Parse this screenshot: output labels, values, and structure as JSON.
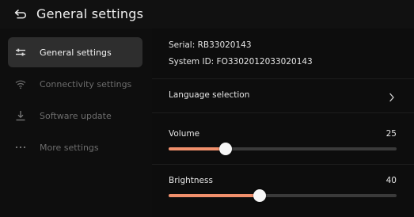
{
  "header": {
    "title": "General settings",
    "back_icon": "back-arrow-icon"
  },
  "sidebar": {
    "items": [
      {
        "label": "General settings",
        "icon": "sliders-icon",
        "active": true
      },
      {
        "label": "Connectivity settings",
        "icon": "wifi-icon",
        "active": false
      },
      {
        "label": "Software update",
        "icon": "download-icon",
        "active": false
      },
      {
        "label": "More settings",
        "icon": "more-dots-icon",
        "active": false
      }
    ]
  },
  "main": {
    "serial": "Serial: RB33020143",
    "system_id": "System ID: FO3302012033020143",
    "language": {
      "label": "Language selection",
      "icon": "chevron-right-icon"
    },
    "volume": {
      "label": "Volume",
      "value": "25",
      "level": 0.25
    },
    "brightness": {
      "label": "Brightness",
      "value": "40",
      "level": 0.4
    }
  },
  "colors": {
    "accent": "#f1906c",
    "active_bg": "#2e2e2e",
    "inactive_text": "#6d6d6d",
    "text": "#e6e6e6"
  }
}
